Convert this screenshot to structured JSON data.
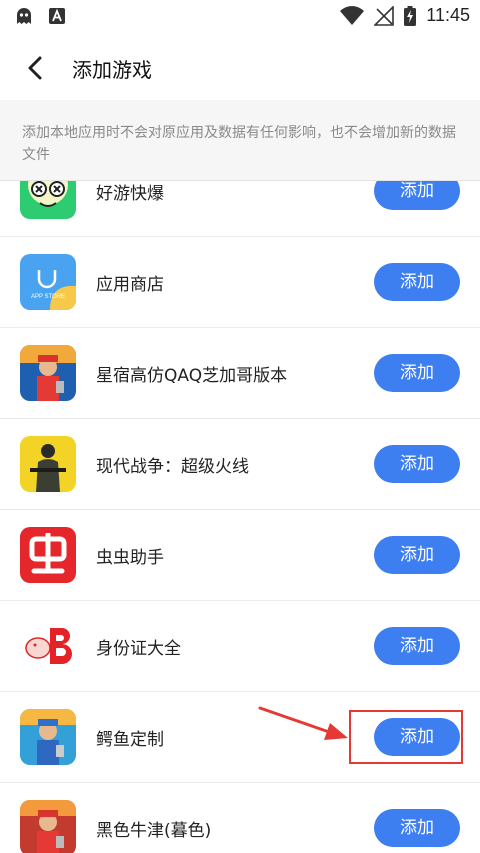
{
  "status_bar": {
    "time": "11:45"
  },
  "header": {
    "title": "添加游戏"
  },
  "notice": "添加本地应用时不会对原应用及数据有任何影响，也不会增加新的数据文件",
  "apps": [
    {
      "name": "好游快爆",
      "button": "添加"
    },
    {
      "name": "应用商店",
      "button": "添加",
      "icon_label": "APP STORE"
    },
    {
      "name": "星宿高仿QAQ芝加哥版本",
      "button": "添加"
    },
    {
      "name": "现代战争：超级火线",
      "button": "添加"
    },
    {
      "name": "虫虫助手",
      "button": "添加"
    },
    {
      "name": "身份证大全",
      "button": "添加"
    },
    {
      "name": "鳄鱼定制",
      "button": "添加"
    },
    {
      "name": "黑色牛津(暮色)",
      "button": "添加"
    }
  ],
  "colors": {
    "accent": "#3d7ef0",
    "highlight": "#e53935"
  }
}
